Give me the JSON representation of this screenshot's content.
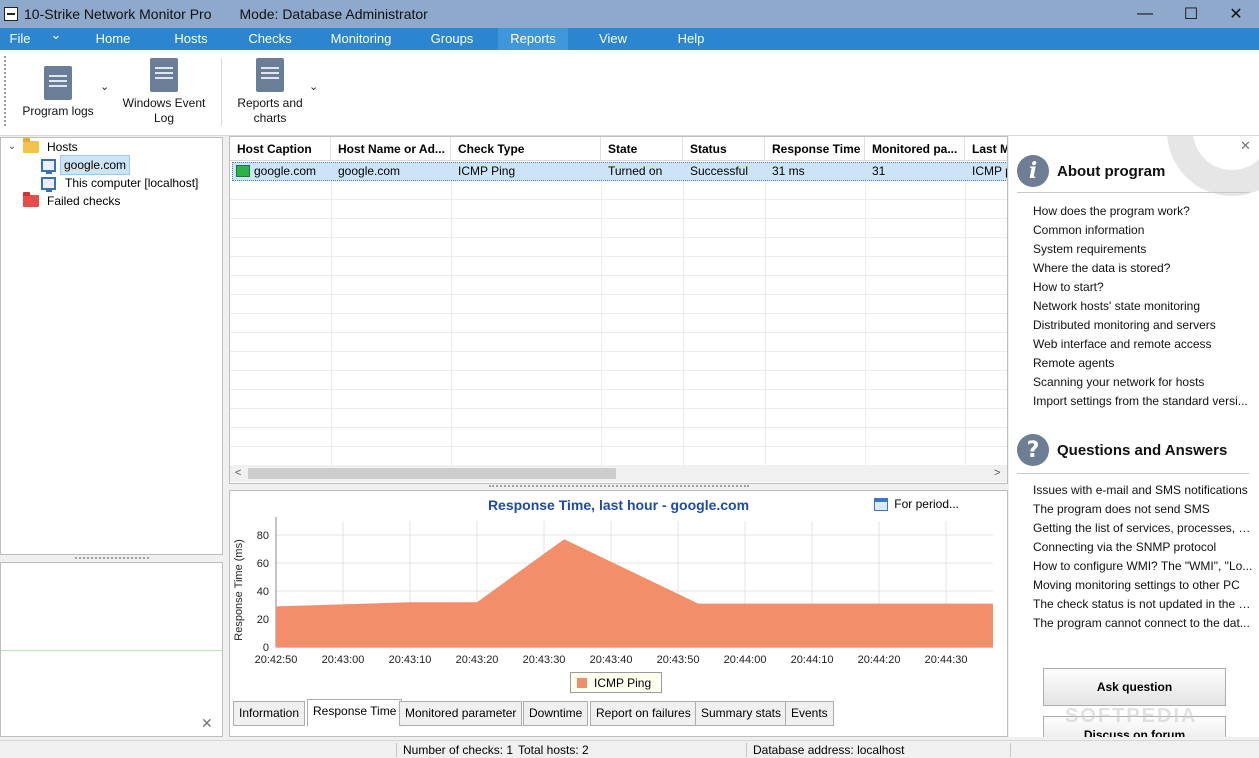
{
  "window": {
    "title": "10-Strike Network Monitor Pro",
    "mode": "Mode: Database Administrator",
    "minimize_glyph": "—",
    "maximize_glyph": "☐",
    "close_glyph": "✕"
  },
  "menu": {
    "file": "File",
    "file_dropdown_glyph": "⌄",
    "items": [
      "Home",
      "Hosts",
      "Checks",
      "Monitoring",
      "Groups",
      "Reports",
      "View",
      "Help"
    ],
    "active": "Reports"
  },
  "ribbon": {
    "program_logs": "Program logs",
    "windows_event_log_1": "Windows Event",
    "windows_event_log_2": "Log",
    "reports_charts_1": "Reports and",
    "reports_charts_2": "charts",
    "dropdown_glyph": "⌄"
  },
  "tree": {
    "expand_glyph": "⌄",
    "hosts": "Hosts",
    "host1": "google.com",
    "host2": "This computer [localhost]",
    "failed": "Failed checks"
  },
  "grid": {
    "columns": [
      "Host Caption",
      "Host Name or Ad...",
      "Check Type",
      "State",
      "Status",
      "Response Time",
      "Monitored pa...",
      "Last M"
    ],
    "rows": [
      [
        "google.com",
        "google.com",
        "ICMP Ping",
        "Turned on",
        "Successful",
        "31 ms",
        "31",
        "ICMP p"
      ]
    ],
    "scroll_left": "<",
    "scroll_right": ">"
  },
  "chart_panel": {
    "title": "Response Time, last hour - google.com",
    "for_period": "For period..."
  },
  "chart_data": {
    "type": "area",
    "title": "Response Time, last hour - google.com",
    "xlabel": "",
    "ylabel": "Response Time (ms)",
    "ylim": [
      0,
      90
    ],
    "yticks": [
      0,
      20,
      40,
      60,
      80
    ],
    "xticks": [
      "20:42:50",
      "20:43:00",
      "20:43:10",
      "20:43:20",
      "20:43:30",
      "20:43:40",
      "20:43:50",
      "20:44:00",
      "20:44:10",
      "20:44:20",
      "20:44:30"
    ],
    "xrange_seconds": [
      0,
      107
    ],
    "series": [
      {
        "name": "ICMP Ping",
        "color": "#f28e6a",
        "points": [
          [
            0,
            29
          ],
          [
            20,
            32
          ],
          [
            30,
            32
          ],
          [
            43,
            77
          ],
          [
            63,
            31
          ],
          [
            107,
            31
          ]
        ]
      }
    ],
    "grid": true,
    "legend": "bottom-center"
  },
  "tabs": [
    "Information",
    "Response Time",
    "Monitored parameter",
    "Downtime",
    "Report on failures",
    "Summary stats",
    "Events"
  ],
  "active_tab": "Response Time",
  "right_panel": {
    "about_title": "About program",
    "about_links": [
      "How does the program work?",
      "Common information",
      "System requirements",
      "Where the data is stored?",
      "How to start?",
      "Network hosts' state monitoring",
      "Distributed monitoring and servers",
      "Web interface and remote access",
      "Remote agents",
      "Scanning your network for hosts",
      "Import settings from the standard versi..."
    ],
    "qa_title": "Questions and Answers",
    "qa_links": [
      "Issues with e-mail and SMS notifications",
      "The program does not send SMS",
      "Getting the list of services, processes, a...",
      "Connecting via the SNMP protocol",
      "How to configure WMI? The \"WMI\", \"Lo...",
      "Moving monitoring settings to other PC",
      "The check status is not updated in the c...",
      "The program cannot connect to the dat..."
    ],
    "ask_button": "Ask question",
    "forum_button": "Discuss on forum",
    "close_glyph": "✕",
    "info_glyph": "i",
    "qa_glyph": "?"
  },
  "statusbar": {
    "checks": "Number of checks: 1",
    "hosts": "Total hosts: 2",
    "db": "Database address: localhost"
  },
  "watermark": "SOFTPEDIA",
  "misc": {
    "panel_close_glyph": "✕"
  }
}
